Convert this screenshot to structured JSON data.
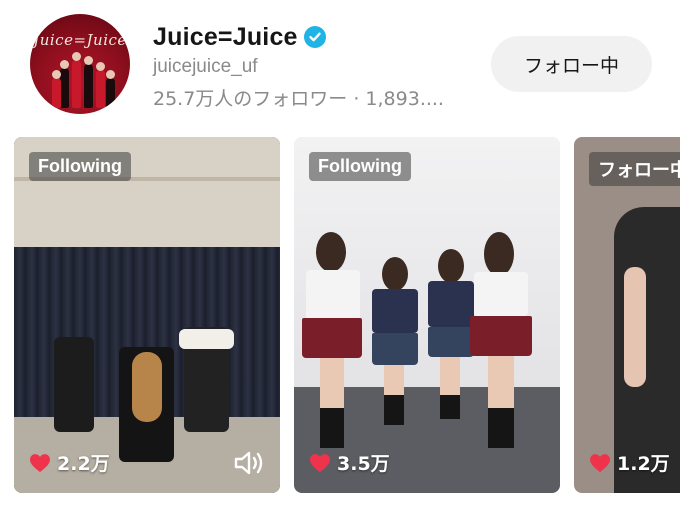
{
  "profile": {
    "name": "Juice=Juice",
    "avatar_logo_text": "Juice=Juice",
    "handle": "juicejuice_uf",
    "stats": "25.7万人のフォロワー · 1,893....",
    "verified": true
  },
  "follow_button": {
    "label": "フォロー中"
  },
  "videos": [
    {
      "badge": "Following",
      "likes": "2.2万",
      "has_sound_icon": true
    },
    {
      "badge": "Following",
      "likes": "3.5万",
      "has_sound_icon": false
    },
    {
      "badge": "フォロー中",
      "likes": "1.2万",
      "has_sound_icon": false
    }
  ],
  "colors": {
    "like_heart": "#f0334c",
    "verified": "#20b4e6",
    "follow_bg": "#f1f1f2"
  },
  "icons": [
    "verified-check-icon",
    "heart-icon",
    "sound-icon"
  ]
}
